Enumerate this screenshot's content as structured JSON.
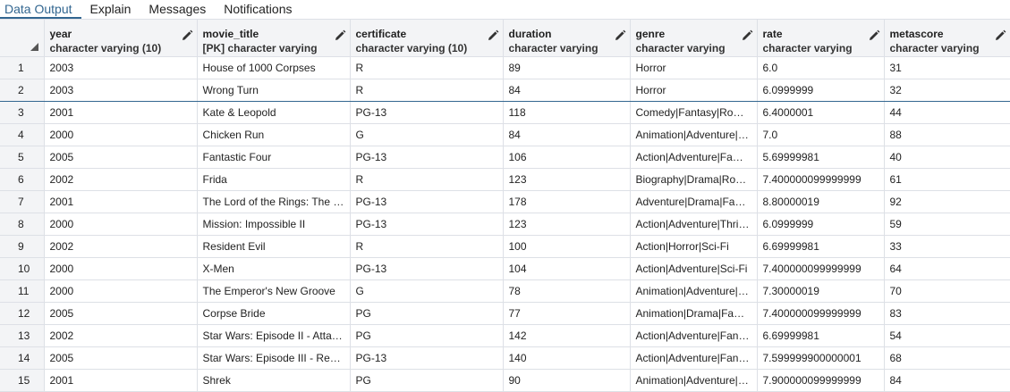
{
  "tabs": [
    {
      "label": "Data Output",
      "active": true
    },
    {
      "label": "Explain",
      "active": false
    },
    {
      "label": "Messages",
      "active": false
    },
    {
      "label": "Notifications",
      "active": false
    }
  ],
  "columns": [
    {
      "name": "year",
      "type": "character varying (10)"
    },
    {
      "name": "movie_title",
      "type": "[PK] character varying"
    },
    {
      "name": "certificate",
      "type": "character varying (10)"
    },
    {
      "name": "duration",
      "type": "character varying"
    },
    {
      "name": "genre",
      "type": "character varying"
    },
    {
      "name": "rate",
      "type": "character varying"
    },
    {
      "name": "metascore",
      "type": "character varying"
    }
  ],
  "rows": [
    [
      "1",
      "2003",
      "House of 1000 Corpses",
      "R",
      "89",
      "Horror",
      "6.0",
      "31"
    ],
    [
      "2",
      "2003",
      "Wrong Turn",
      "R",
      "84",
      "Horror",
      "6.0999999",
      "32"
    ],
    [
      "3",
      "2001",
      "Kate & Leopold",
      "PG-13",
      "118",
      "Comedy|Fantasy|Romance",
      "6.4000001",
      "44"
    ],
    [
      "4",
      "2000",
      "Chicken Run",
      "G",
      "84",
      "Animation|Adventure|Comedy",
      "7.0",
      "88"
    ],
    [
      "5",
      "2005",
      "Fantastic Four",
      "PG-13",
      "106",
      "Action|Adventure|Family",
      "5.69999981",
      "40"
    ],
    [
      "6",
      "2002",
      "Frida",
      "R",
      "123",
      "Biography|Drama|Romance",
      "7.400000099999999",
      "61"
    ],
    [
      "7",
      "2001",
      "The Lord of the Rings: The Fellowship of the Ring",
      "PG-13",
      "178",
      "Adventure|Drama|Fantasy",
      "8.80000019",
      "92"
    ],
    [
      "8",
      "2000",
      "Mission: Impossible II",
      "PG-13",
      "123",
      "Action|Adventure|Thriller",
      "6.0999999",
      "59"
    ],
    [
      "9",
      "2002",
      "Resident Evil",
      "R",
      "100",
      "Action|Horror|Sci-Fi",
      "6.69999981",
      "33"
    ],
    [
      "10",
      "2000",
      "X-Men",
      "PG-13",
      "104",
      "Action|Adventure|Sci-Fi",
      "7.400000099999999",
      "64"
    ],
    [
      "11",
      "2000",
      "The Emperor's New Groove",
      "G",
      "78",
      "Animation|Adventure|Comedy",
      "7.30000019",
      "70"
    ],
    [
      "12",
      "2005",
      "Corpse Bride",
      "PG",
      "77",
      "Animation|Drama|Family",
      "7.400000099999999",
      "83"
    ],
    [
      "13",
      "2002",
      "Star Wars: Episode II - Attack of the Clones",
      "PG",
      "142",
      "Action|Adventure|Fantasy",
      "6.69999981",
      "54"
    ],
    [
      "14",
      "2005",
      "Star Wars: Episode III - Revenge of the Sith",
      "PG-13",
      "140",
      "Action|Adventure|Fantasy",
      "7.599999900000001",
      "68"
    ],
    [
      "15",
      "2001",
      "Shrek",
      "PG",
      "90",
      "Animation|Adventure|Comedy",
      "7.900000099999999",
      "84"
    ]
  ],
  "icons": {
    "edit": "pencil-icon",
    "select_all": "select-all-corner-icon"
  },
  "colors": {
    "accent": "#326690",
    "header_bg": "#f3f4f6",
    "grid_line": "#dde0e6"
  }
}
